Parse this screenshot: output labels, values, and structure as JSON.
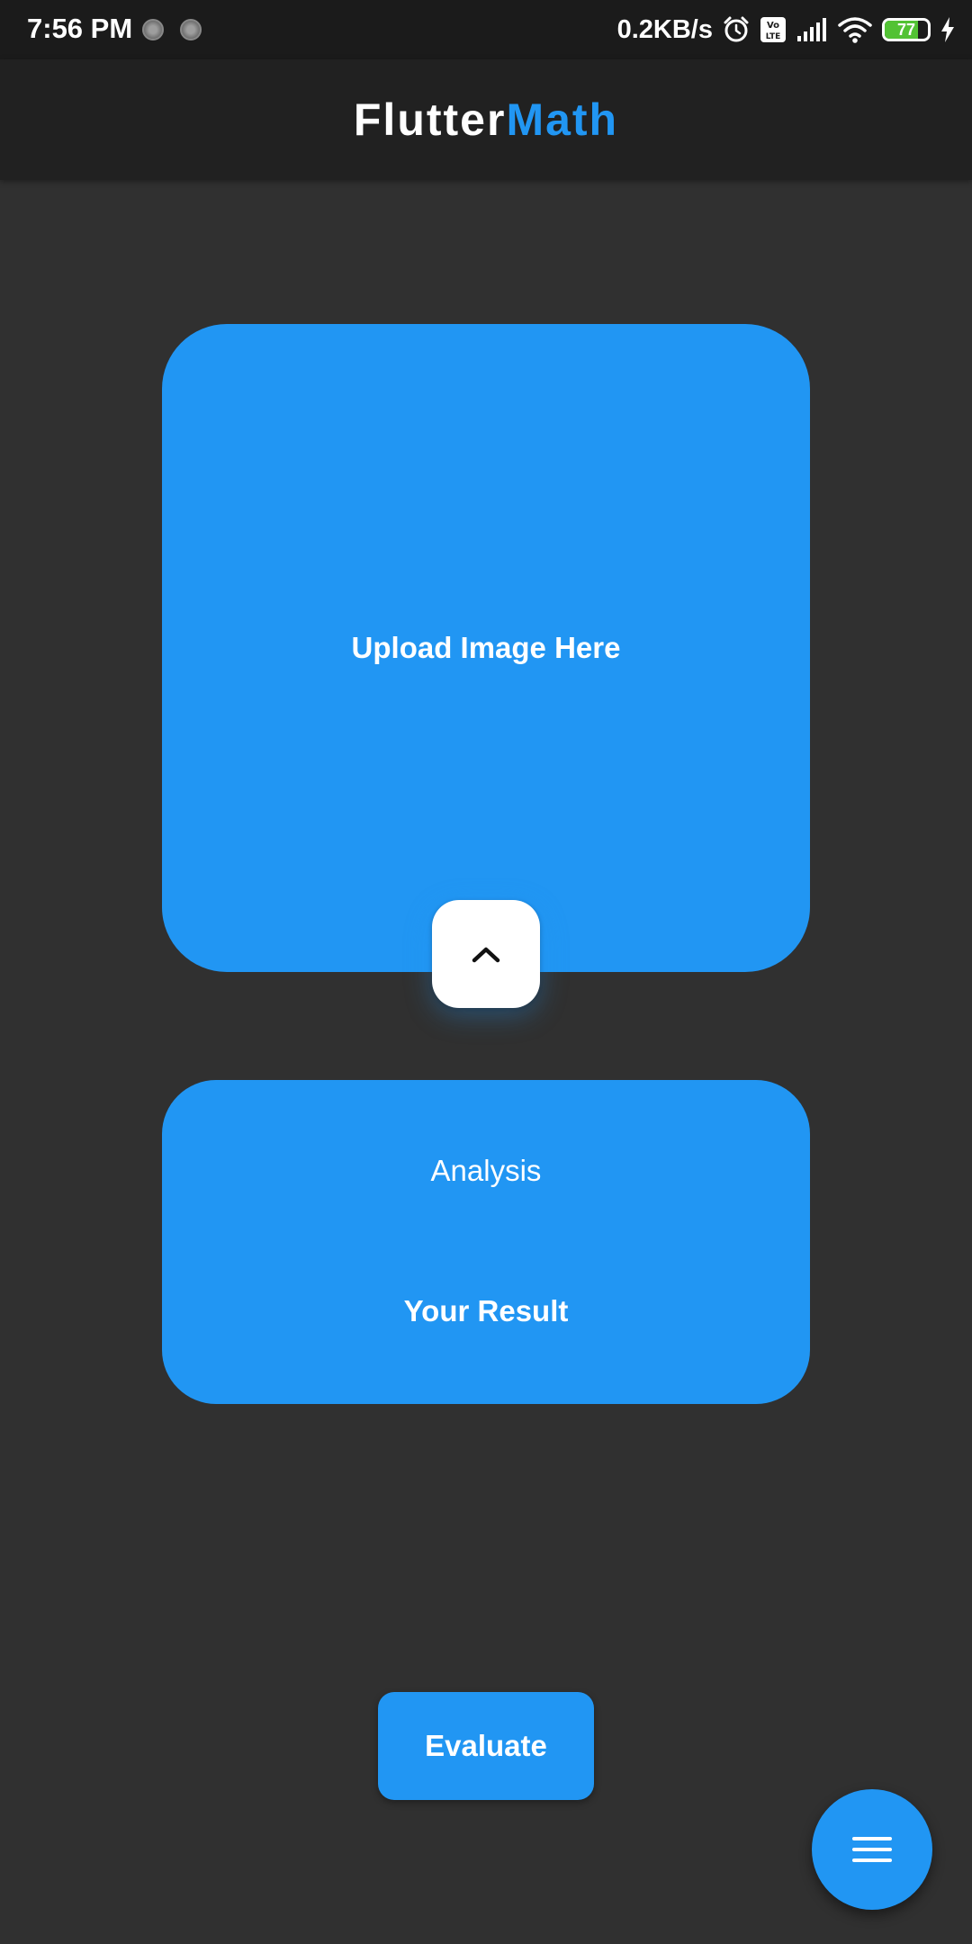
{
  "status_bar": {
    "time": "7:56 PM",
    "net_speed": "0.2KB/s",
    "battery_level": "77",
    "battery_percent": 77,
    "icons": [
      "notification-dot-icon",
      "alarm-icon",
      "volte-icon",
      "signal-icon",
      "wifi-icon",
      "battery-icon",
      "charging-icon"
    ]
  },
  "app_bar": {
    "title_part1": "Flutter",
    "title_part2": "Math"
  },
  "upload": {
    "label": "Upload Image Here",
    "toggle_icon": "chevron-up-icon"
  },
  "result": {
    "heading": "Analysis",
    "value": "Your Result"
  },
  "actions": {
    "evaluate_label": "Evaluate",
    "fab_icon": "menu-icon"
  },
  "colors": {
    "accent": "#2196F3",
    "background": "#303030",
    "app_bar": "#212121"
  }
}
